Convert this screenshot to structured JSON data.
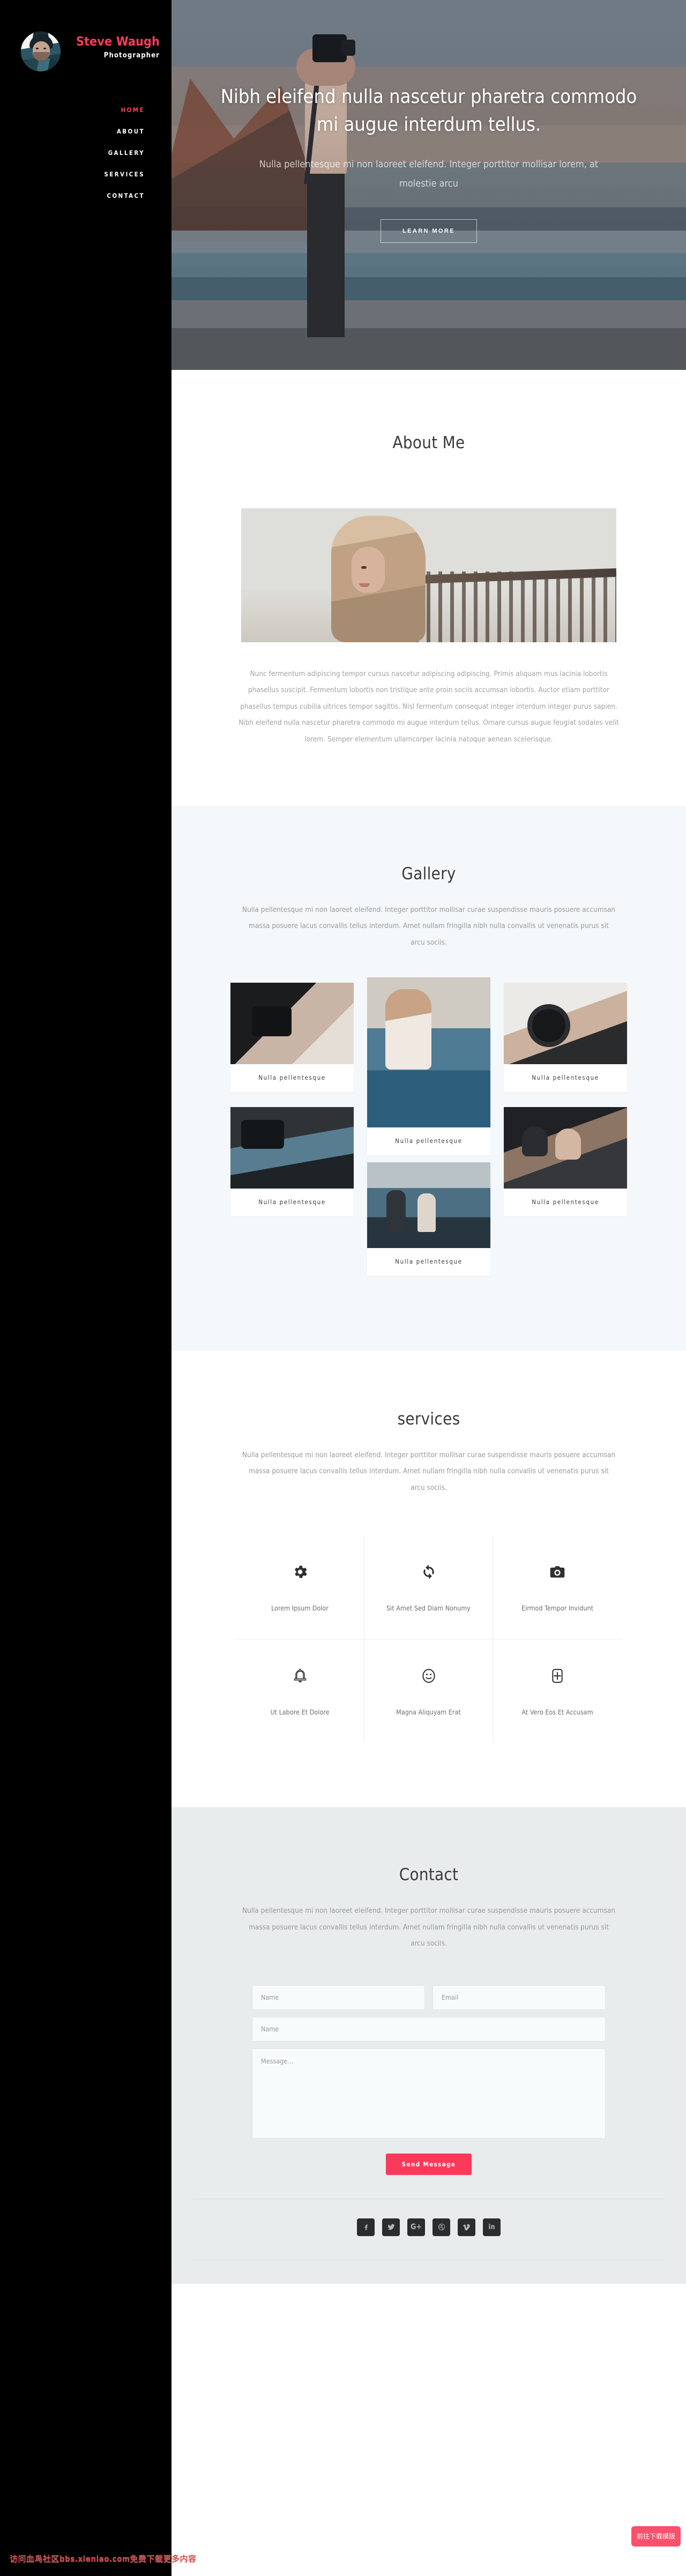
{
  "brand": {
    "name": "Steve Waugh",
    "role": "Photographer",
    "accent": "#f93e5c"
  },
  "nav": {
    "items": [
      {
        "label": "HOME",
        "active": true
      },
      {
        "label": "ABOUT",
        "active": false
      },
      {
        "label": "GALLERY",
        "active": false
      },
      {
        "label": "SERVICES",
        "active": false
      },
      {
        "label": "CONTACT",
        "active": false
      }
    ]
  },
  "hero": {
    "title": "Nibh eleifend nulla nascetur pharetra commodo mi augue interdum tellus.",
    "subtitle": "Nulla pellentesque mi non laoreet eleifend. Integer porttitor mollisar lorem, at molestie arcu",
    "button": "LEARN MORE"
  },
  "about": {
    "title": "About Me",
    "body": "Nunc fermentum adipiscing tempor cursus nascetur adipiscing adipiscing. Primis aliquam mus lacinia lobortis phasellus suscipit. Fermentum lobortis non tristique ante proin sociis accumsan lobortis. Auctor etiam porttitor phasellus tempus cubilia ultrices tempor sagittis. Nisl fermentum consequat integer interdum integer purus sapien. Nibh eleifend nulla nascetur pharetra commodo mi augue interdum tellus. Ornare cursus augue feugiat sodales velit lorem. Semper elementum ullamcorper lacinia natoque aenean scelerisque."
  },
  "gallery": {
    "title": "Gallery",
    "lede": "Nulla pellentesque mi non laoreet eleifend. Integer porttitor mollisar curae suspendisse mauris posuere accumsan massa posuere lacus convallis tellus interdum. Amet nullam fringilla nibh nulla convallis ut venenatis purus sit arcu sociis.",
    "items": [
      {
        "caption": "Nulla pellentesque"
      },
      {
        "caption": "Nulla pellentesque"
      },
      {
        "caption": "Nulla pellentesque"
      },
      {
        "caption": "Nulla pellentesque"
      },
      {
        "caption": "Nulla pellentesque"
      },
      {
        "caption": "Nulla pellentesque"
      }
    ]
  },
  "services": {
    "title": "services",
    "lede": "Nulla pellentesque mi non laoreet eleifend. Integer porttitor mollisar curae suspendisse mauris posuere accumsan massa posuere lacus convallis tellus interdum. Amet nullam fringilla nibh nulla convallis ut venenatis purus sit arcu sociis.",
    "items": [
      {
        "icon": "gear-icon",
        "label": "Lorem Ipsum Dolor"
      },
      {
        "icon": "refresh-icon",
        "label": "Sit Amet Sed Diam Nonumy"
      },
      {
        "icon": "camera-icon",
        "label": "Eirmod Tempor Invidunt"
      },
      {
        "icon": "bell-icon",
        "label": "Ut Labore Et Dolore"
      },
      {
        "icon": "smiley-icon",
        "label": "Magna Aliquyam Erat"
      },
      {
        "icon": "plus-box-icon",
        "label": "At Vero Eos Et Accusam"
      }
    ]
  },
  "contact": {
    "title": "Contact",
    "lede": "Nulla pellentesque mi non laoreet eleifend. Integer porttitor mollisar curae suspendisse mauris posuere accumsan massa posuere lacus convallis tellus interdum. Amet nullam fringilla nibh nulla convallis ut venenatis purus sit arcu sociis.",
    "fields": {
      "name_placeholder": "Name",
      "email_placeholder": "Email",
      "subject_placeholder": "Name",
      "message_placeholder": "Message..."
    },
    "submit": "Send Message"
  },
  "footer": {
    "socials": [
      {
        "name": "facebook-icon",
        "glyph": "f"
      },
      {
        "name": "twitter-icon",
        "glyph": "t"
      },
      {
        "name": "googleplus-icon",
        "glyph": "G+"
      },
      {
        "name": "dribbble-icon",
        "glyph": "d"
      },
      {
        "name": "vimeo-icon",
        "glyph": "v"
      },
      {
        "name": "linkedin-icon",
        "glyph": "in"
      }
    ]
  },
  "watermark": {
    "text": "访问血鸟社区bbs.xieniao.com免费下载更多内容",
    "button": "前往下载模版"
  }
}
